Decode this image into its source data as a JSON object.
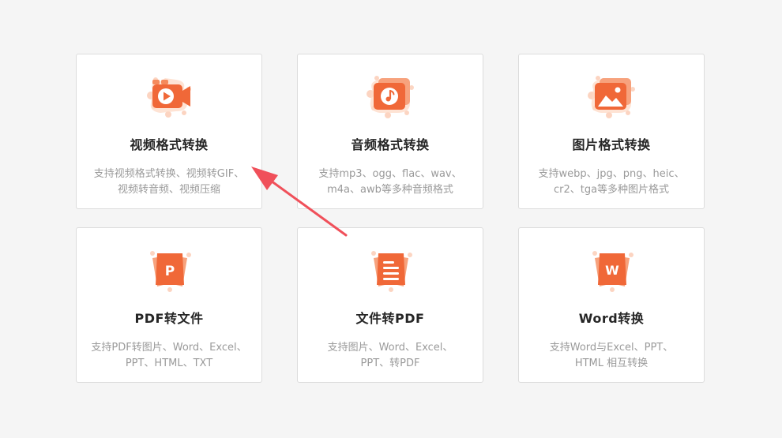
{
  "colors": {
    "accent": "#f06838",
    "accent_light": "#fbb595",
    "arrow": "#f0505a"
  },
  "cards": [
    {
      "icon": "video-camera-icon",
      "title": "视频格式转换",
      "desc_lines": [
        "支持视频格式转换、视频转GIF、",
        "视频转音频、视频压缩"
      ]
    },
    {
      "icon": "music-note-icon",
      "title": "音频格式转换",
      "desc_lines": [
        "支持mp3、ogg、flac、wav、",
        "m4a、awb等多种音频格式"
      ]
    },
    {
      "icon": "image-icon",
      "title": "图片格式转换",
      "desc_lines": [
        "支持webp、jpg、png、heic、",
        "cr2、tga等多种图片格式"
      ]
    },
    {
      "icon": "pdf-p-icon",
      "icon_letter": "P",
      "title": "PDF转文件",
      "desc_lines": [
        "支持PDF转图片、Word、Excel、",
        "PPT、HTML、TXT"
      ]
    },
    {
      "icon": "document-lines-icon",
      "title": "文件转PDF",
      "desc_lines": [
        "支持图片、Word、Excel、",
        "PPT、转PDF"
      ]
    },
    {
      "icon": "word-w-icon",
      "icon_letter": "W",
      "title": "Word转换",
      "desc_lines": [
        "支持Word与Excel、PPT、",
        "HTML 相互转换"
      ]
    }
  ],
  "annotation": {
    "icon": "red-arrow-icon"
  }
}
